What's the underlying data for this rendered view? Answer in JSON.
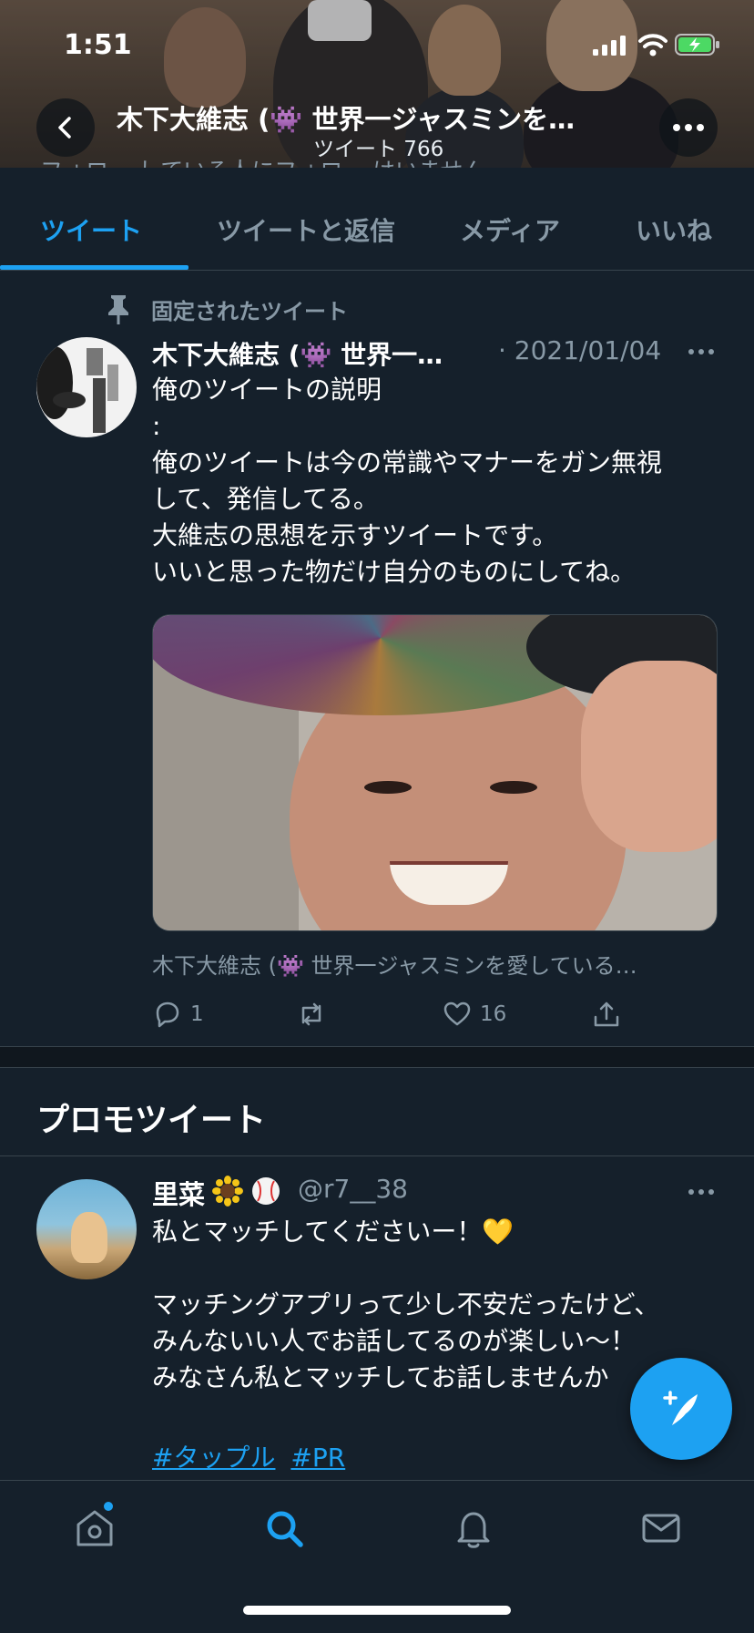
{
  "status_bar": {
    "time": "1:51"
  },
  "header": {
    "name": "木下大維志 (👾 世界一ジャスミンを…",
    "tweet_count": "ツイート 766",
    "peek_text": "フォロー している人にフォロー はいません"
  },
  "tabs": [
    {
      "label": "ツイート",
      "active": true
    },
    {
      "label": "ツイートと返信",
      "active": false
    },
    {
      "label": "メディア",
      "active": false
    },
    {
      "label": "いいね",
      "active": false
    }
  ],
  "pinned_tweet": {
    "pin_label": "固定されたツイート",
    "author": "木下大維志 (👾 世界一…",
    "date": "· 2021/01/04",
    "body": "俺のツイートの説明\n:\n俺のツイートは今の常識やマナーをガン無視\nして、発信してる。\n大維志の思想を示すツイートです。\nいいと思った物だけ自分のものにしてね。",
    "attribution": "木下大維志 (👾 世界一ジャスミンを愛している…",
    "reply_count": "1",
    "retweet_count": "",
    "like_count": "16"
  },
  "promo": {
    "heading": "プロモツイート",
    "name": "里菜",
    "emoji_1": "🌻",
    "emoji_2": "⚾",
    "handle": "@r7__38",
    "body": "私とマッチしてくださいー！💛\n\nマッチングアプリって少し不安だったけど、\nみんないい人でお話してるのが楽しい〜！\nみなさん私とマッチしてお話しませんか",
    "hashtags": [
      "#タップル",
      "#PR"
    ]
  },
  "colors": {
    "background": "#15202b",
    "accent": "#1da1f2",
    "secondary_text": "#8899a6",
    "border": "#38444d"
  },
  "icons": {
    "back": "chevron-left-icon",
    "more": "more-horizontal-icon",
    "pin": "pin-icon",
    "reply": "reply-icon",
    "retweet": "retweet-icon",
    "like": "heart-icon",
    "share": "share-icon",
    "compose": "compose-tweet-icon",
    "home": "home-icon",
    "search": "search-icon",
    "notifications": "bell-icon",
    "messages": "mail-icon"
  }
}
